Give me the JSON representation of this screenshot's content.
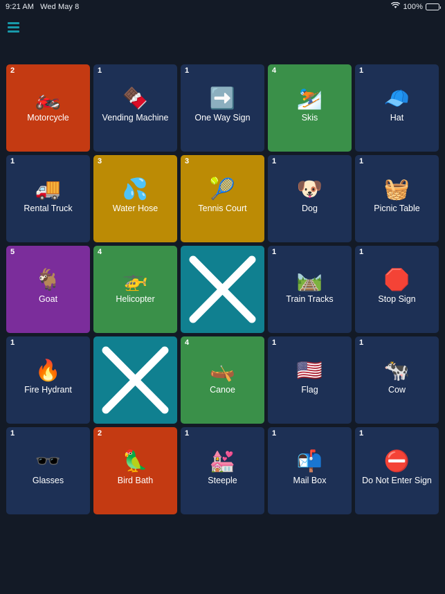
{
  "status_bar": {
    "time": "9:21 AM",
    "date": "Wed May 8",
    "wifi_icon": "wifi-icon",
    "battery_percent": "100%",
    "battery_icon": "battery-full-icon"
  },
  "nav": {
    "menu_icon": "hamburger-menu-icon",
    "menu_color": "#1899aa"
  },
  "palette": {
    "background": "#131a26",
    "tile_default": "#1d3055",
    "tile_orange": "#c43a12",
    "tile_gold": "#bc8b05",
    "tile_green": "#3a9049",
    "tile_purple": "#7b2d9b",
    "tile_teal": "#108090",
    "text": "#ffffff"
  },
  "board": {
    "columns": 5,
    "rows": 5,
    "tiles": [
      {
        "badge": "2",
        "label": "Motorcycle",
        "emoji": "🏍️",
        "color": "#c43a12",
        "marked": false
      },
      {
        "badge": "1",
        "label": "Vending Machine",
        "emoji": "🍫",
        "color": "#1d3055",
        "marked": false
      },
      {
        "badge": "1",
        "label": "One Way Sign",
        "emoji": "➡️",
        "color": "#1d3055",
        "marked": false
      },
      {
        "badge": "4",
        "label": "Skis",
        "emoji": "⛷️",
        "color": "#3a9049",
        "marked": false
      },
      {
        "badge": "1",
        "label": "Hat",
        "emoji": "🧢",
        "color": "#1d3055",
        "marked": false
      },
      {
        "badge": "1",
        "label": "Rental Truck",
        "emoji": "🚚",
        "color": "#1d3055",
        "marked": false
      },
      {
        "badge": "3",
        "label": "Water Hose",
        "emoji": "💦",
        "color": "#bc8b05",
        "marked": false
      },
      {
        "badge": "3",
        "label": "Tennis Court",
        "emoji": "🎾",
        "color": "#bc8b05",
        "marked": false
      },
      {
        "badge": "1",
        "label": "Dog",
        "emoji": "🐶",
        "color": "#1d3055",
        "marked": false
      },
      {
        "badge": "1",
        "label": "Picnic Table",
        "emoji": "🧺",
        "color": "#1d3055",
        "marked": false
      },
      {
        "badge": "5",
        "label": "Goat",
        "emoji": "🐐",
        "color": "#7b2d9b",
        "marked": false
      },
      {
        "badge": "4",
        "label": "Helicopter",
        "emoji": "🚁",
        "color": "#3a9049",
        "marked": false
      },
      {
        "badge": "",
        "label": "",
        "emoji": "",
        "color": "#108090",
        "marked": true
      },
      {
        "badge": "1",
        "label": "Train Tracks",
        "emoji": "🛤️",
        "color": "#1d3055",
        "marked": false
      },
      {
        "badge": "1",
        "label": "Stop Sign",
        "emoji": "🛑",
        "color": "#1d3055",
        "marked": false
      },
      {
        "badge": "1",
        "label": "Fire Hydrant",
        "emoji": "🔥",
        "color": "#1d3055",
        "marked": false
      },
      {
        "badge": "",
        "label": "",
        "emoji": "",
        "color": "#108090",
        "marked": true
      },
      {
        "badge": "4",
        "label": "Canoe",
        "emoji": "🛶",
        "color": "#3a9049",
        "marked": false
      },
      {
        "badge": "1",
        "label": "Flag",
        "emoji": "🇺🇸",
        "color": "#1d3055",
        "marked": false
      },
      {
        "badge": "1",
        "label": "Cow",
        "emoji": "🐄",
        "color": "#1d3055",
        "marked": false
      },
      {
        "badge": "1",
        "label": "Glasses",
        "emoji": "🕶️",
        "color": "#1d3055",
        "marked": false
      },
      {
        "badge": "2",
        "label": "Bird Bath",
        "emoji": "🦜",
        "color": "#c43a12",
        "marked": false
      },
      {
        "badge": "1",
        "label": "Steeple",
        "emoji": "💒",
        "color": "#1d3055",
        "marked": false
      },
      {
        "badge": "1",
        "label": "Mail Box",
        "emoji": "📬",
        "color": "#1d3055",
        "marked": false
      },
      {
        "badge": "1",
        "label": "Do Not Enter Sign",
        "emoji": "⛔",
        "color": "#1d3055",
        "marked": false
      }
    ]
  }
}
